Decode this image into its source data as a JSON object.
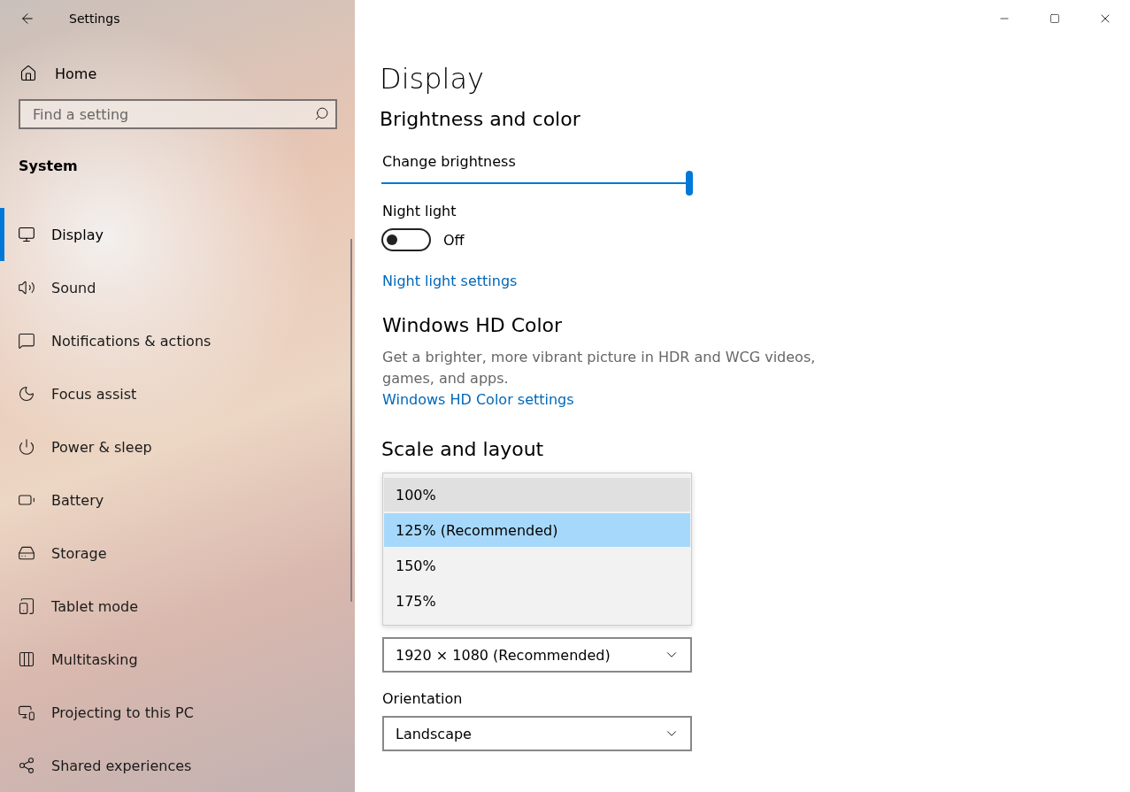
{
  "window": {
    "title": "Settings"
  },
  "sidebar": {
    "home": "Home",
    "search": {
      "placeholder": "Find a setting"
    },
    "section": "System",
    "items": [
      {
        "label": "Display",
        "selected": true
      },
      {
        "label": "Sound",
        "selected": false
      },
      {
        "label": "Notifications & actions",
        "selected": false
      },
      {
        "label": "Focus assist",
        "selected": false
      },
      {
        "label": "Power & sleep",
        "selected": false
      },
      {
        "label": "Battery",
        "selected": false
      },
      {
        "label": "Storage",
        "selected": false
      },
      {
        "label": "Tablet mode",
        "selected": false
      },
      {
        "label": "Multitasking",
        "selected": false
      },
      {
        "label": "Projecting to this PC",
        "selected": false
      },
      {
        "label": "Shared experiences",
        "selected": false
      }
    ]
  },
  "main": {
    "title": "Display",
    "brightness_section": {
      "heading": "Brightness and color",
      "slider_label": "Change brightness",
      "level": 1.0,
      "night_light_label": "Night light",
      "night_light_on": false,
      "night_light_state": "Off",
      "link": "Night light settings"
    },
    "hd_color": {
      "heading": "Windows HD Color",
      "description": "Get a brighter, more vibrant picture in HDR and WCG videos, games, and apps.",
      "link": "Windows HD Color settings"
    },
    "scale_layout": {
      "heading": "Scale and layout",
      "scale_options": [
        {
          "label": "100%",
          "selected": false,
          "hovered": true
        },
        {
          "label": "125% (Recommended)",
          "selected": true,
          "hovered": false
        },
        {
          "label": "150%",
          "selected": false,
          "hovered": false
        },
        {
          "label": "175%",
          "selected": false,
          "hovered": false
        }
      ],
      "resolution": "1920 × 1080 (Recommended)",
      "orientation_label": "Orientation",
      "orientation": "Landscape"
    }
  }
}
